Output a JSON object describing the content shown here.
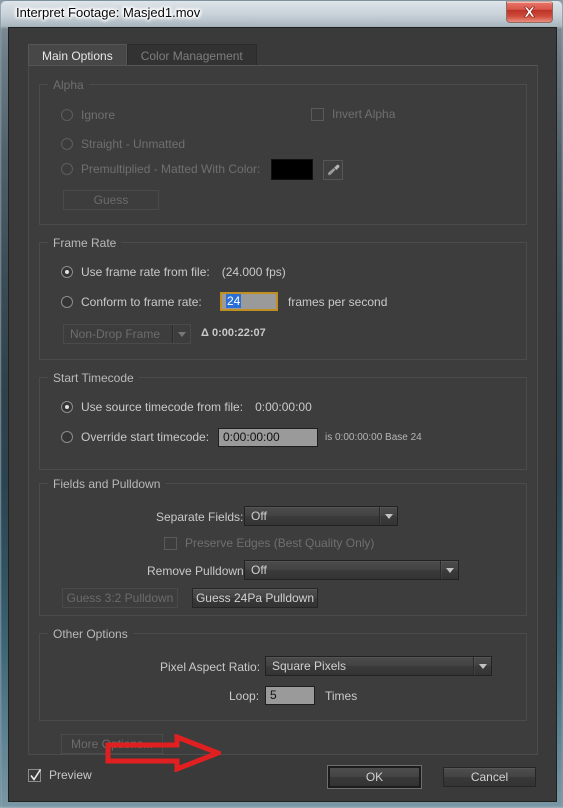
{
  "window": {
    "title": "Interpret Footage: Masjed1.mov",
    "close_label": "Close",
    "accent_red": "#cf3b2c",
    "focus_gold": "#c08f21",
    "selection_blue": "#2a6ed8",
    "panel_bg": "#3d3d3d"
  },
  "tabs": [
    {
      "label": "Main Options",
      "active": true
    },
    {
      "label": "Color Management",
      "active": false
    }
  ],
  "alpha": {
    "legend": "Alpha",
    "enabled": false,
    "ignore_label": "Ignore",
    "straight_label": "Straight - Unmatted",
    "premultiplied_label": "Premultiplied - Matted With Color:",
    "invert_alpha_label": "Invert Alpha",
    "invert_alpha_checked": false,
    "matte_color": "#000000",
    "guess_label": "Guess"
  },
  "frame_rate": {
    "legend": "Frame Rate",
    "use_from_file_label": "Use frame rate from file:",
    "use_from_file_value": "(24.000 fps)",
    "use_from_file_selected": true,
    "conform_label": "Conform to frame rate:",
    "conform_selected": false,
    "conform_value": "24",
    "conform_units": "frames per second",
    "dropframe_value": "Non-Drop Frame",
    "dropframe_enabled": false,
    "duration_label": "Δ 0:00:22:07"
  },
  "start_timecode": {
    "legend": "Start Timecode",
    "use_source_label": "Use source timecode from file:",
    "use_source_value": "0:00:00:00",
    "use_source_selected": true,
    "override_label": "Override start timecode:",
    "override_selected": false,
    "override_value": "0:00:00:00",
    "override_note": "is 0:00:00:00  Base 24"
  },
  "fields_pulldown": {
    "legend": "Fields and Pulldown",
    "separate_fields_label": "Separate Fields:",
    "separate_fields_value": "Off",
    "preserve_edges_label": "Preserve Edges (Best Quality Only)",
    "preserve_edges_checked": false,
    "preserve_edges_enabled": false,
    "remove_pulldown_label": "Remove Pulldown:",
    "remove_pulldown_value": "Off",
    "guess_32_label": "Guess 3:2 Pulldown",
    "guess_32_enabled": false,
    "guess_24pa_label": "Guess 24Pa Pulldown",
    "guess_24pa_enabled": true
  },
  "other_options": {
    "legend": "Other Options",
    "pixel_aspect_label": "Pixel Aspect Ratio:",
    "pixel_aspect_value": "Square Pixels",
    "loop_label": "Loop:",
    "loop_value": "5",
    "loop_units": "Times"
  },
  "more_options": {
    "label": "More Options...",
    "enabled": false
  },
  "footer": {
    "preview_label": "Preview",
    "preview_checked": true,
    "ok_label": "OK",
    "cancel_label": "Cancel"
  },
  "annotation": {
    "type": "arrow",
    "color": "#e02020",
    "direction": "right",
    "points_at": "loop-field"
  }
}
